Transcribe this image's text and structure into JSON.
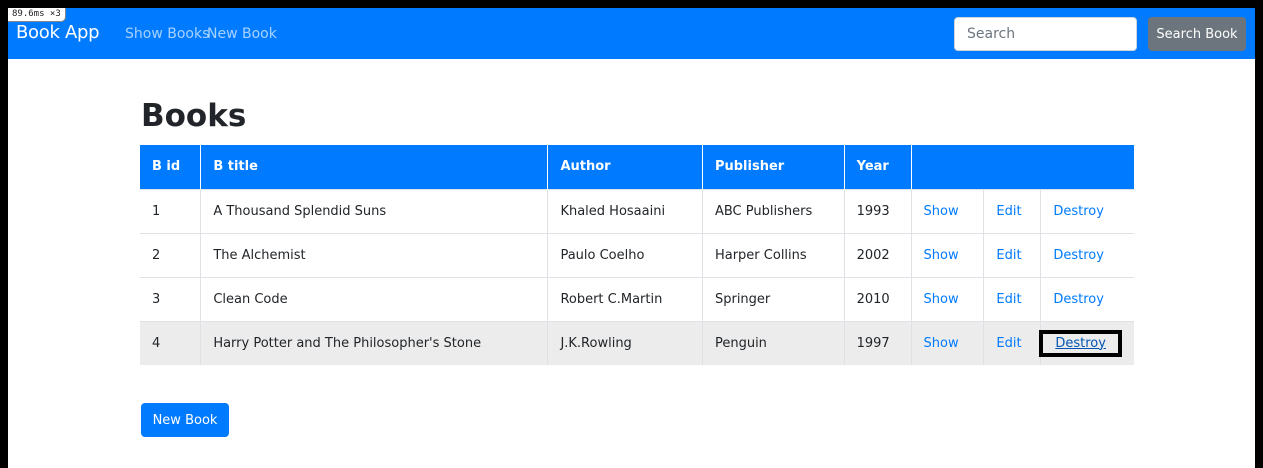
{
  "debug_badge": "89.6ms ×3",
  "navbar": {
    "brand": "Book App",
    "links": [
      "Show Books",
      "New Book"
    ],
    "search_placeholder": "Search",
    "search_button": "Search Book"
  },
  "main": {
    "title": "Books",
    "columns": [
      "B id",
      "B title",
      "Author",
      "Publisher",
      "Year",
      ""
    ],
    "rows": [
      {
        "id": "1",
        "title": "A Thousand Splendid Suns",
        "author": "Khaled Hosaaini",
        "publisher": "ABC Publishers",
        "year": "1993"
      },
      {
        "id": "2",
        "title": "The Alchemist",
        "author": "Paulo Coelho",
        "publisher": "Harper Collins",
        "year": "2002"
      },
      {
        "id": "3",
        "title": "Clean Code",
        "author": "Robert C.Martin",
        "publisher": "Springer",
        "year": "2010"
      },
      {
        "id": "4",
        "title": "Harry Potter and The Philosopher's Stone",
        "author": "J.K.Rowling",
        "publisher": "Penguin",
        "year": "1997"
      }
    ],
    "actions": {
      "show": "Show",
      "edit": "Edit",
      "destroy": "Destroy"
    },
    "new_button": "New Book"
  },
  "colors": {
    "primary": "#007bff",
    "secondary": "#6c757d",
    "hover_row": "#ececec"
  }
}
